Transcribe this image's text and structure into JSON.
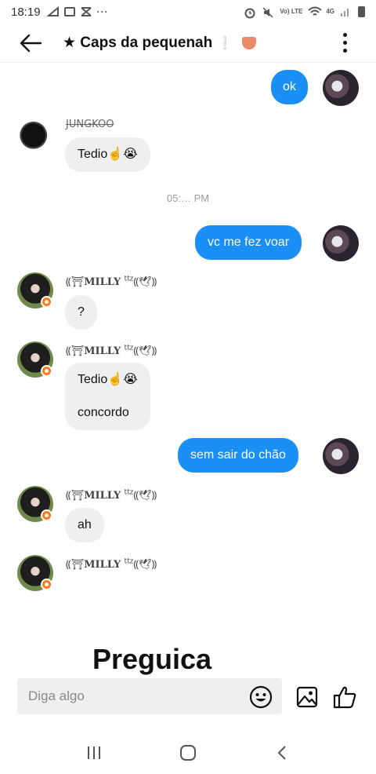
{
  "status_bar": {
    "time": "18:19",
    "network": "4G",
    "lte_label": "Vo) LTE"
  },
  "header": {
    "title": "★ Caps da pequenah",
    "title_deco": "❕"
  },
  "messages": [
    {
      "direction": "out",
      "text": "ok"
    },
    {
      "direction": "in",
      "sender": "JUNGKOO",
      "text": "Tedio☝️😭"
    },
    {
      "timestamp": "05:… PM"
    },
    {
      "direction": "out",
      "text": "vc me fez voar"
    },
    {
      "direction": "in",
      "sender": "MILLY",
      "text": "?"
    },
    {
      "direction": "in",
      "sender": "MILLY",
      "text": "Tedio☝️😭",
      "text2": "concordo"
    },
    {
      "direction": "out",
      "text": "sem sair do chão"
    },
    {
      "direction": "in",
      "sender": "MILLY",
      "text": "ah"
    },
    {
      "direction": "in",
      "sender": "MILLY"
    }
  ],
  "sender_milly": {
    "prefix": "⸨⛩",
    "name": "MILLY",
    "suffix_sup": "ttz",
    "suffix": "⸨🕊︎⸩"
  },
  "overlay_text": "Preguica",
  "composer": {
    "placeholder": "Diga algo"
  },
  "colors": {
    "outgoing_bubble": "#1a8ff5",
    "incoming_bubble": "#efefef",
    "badge": "#ff7a1a"
  }
}
